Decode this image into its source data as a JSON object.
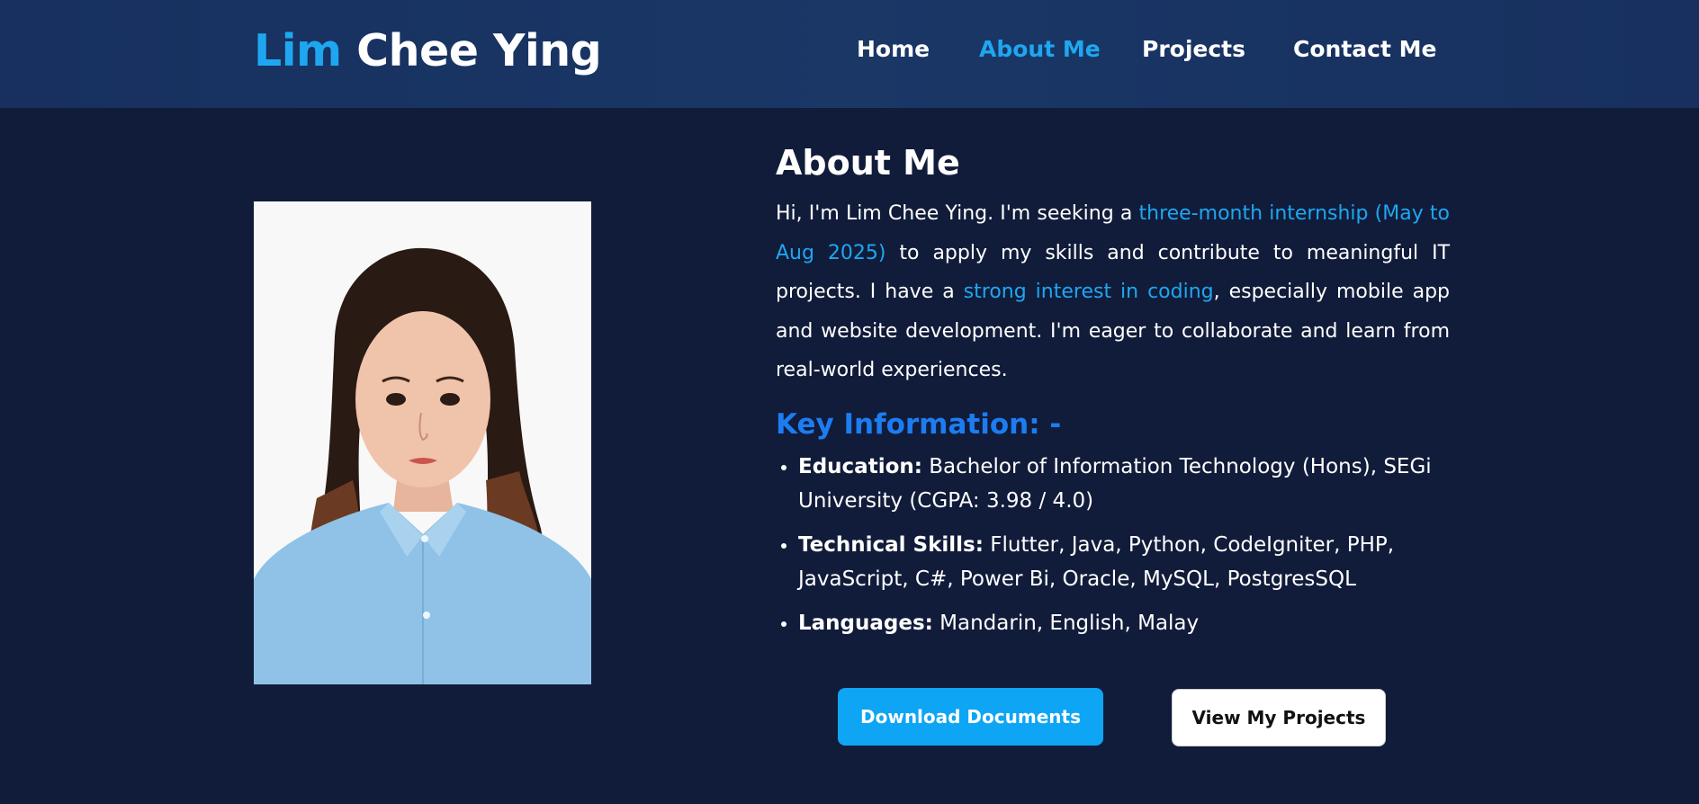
{
  "header": {
    "logo_first": "Lim",
    "logo_rest": " Chee Ying",
    "nav": [
      {
        "label": "Home",
        "active": false
      },
      {
        "label": "About Me",
        "active": true
      },
      {
        "label": "Projects",
        "active": false
      },
      {
        "label": "Contact Me",
        "active": false
      }
    ]
  },
  "about": {
    "title": "About Me",
    "intro": {
      "p1": "Hi, I'm Lim Chee Ying. I'm seeking a ",
      "hl1": "three-month internship (May to Aug 2025)",
      "p2": " to apply my skills and contribute to meaningful IT projects. I have a ",
      "hl2": "strong interest in coding",
      "p3": ", especially mobile app and website development. I'm eager to collaborate and learn from real-world experiences."
    },
    "key_title": "Key Information: -",
    "items": [
      {
        "label": "Education:",
        "value": " Bachelor of Information Technology (Hons), SEGi University (CGPA: 3.98 / 4.0)"
      },
      {
        "label": "Technical Skills:",
        "value": " Flutter, Java, Python, CodeIgniter, PHP, JavaScript, C#, Power Bi, Oracle, MySQL, PostgresSQL"
      },
      {
        "label": "Languages:",
        "value": " Mandarin, English, Malay"
      }
    ]
  },
  "buttons": {
    "download": "Download Documents",
    "projects": "View My Projects"
  },
  "colors": {
    "accent": "#1ea7f0",
    "key_title": "#1c7df2",
    "background": "#111c3a",
    "header": "#17305f"
  },
  "profile_photo": {
    "icon": "profile-photo"
  }
}
